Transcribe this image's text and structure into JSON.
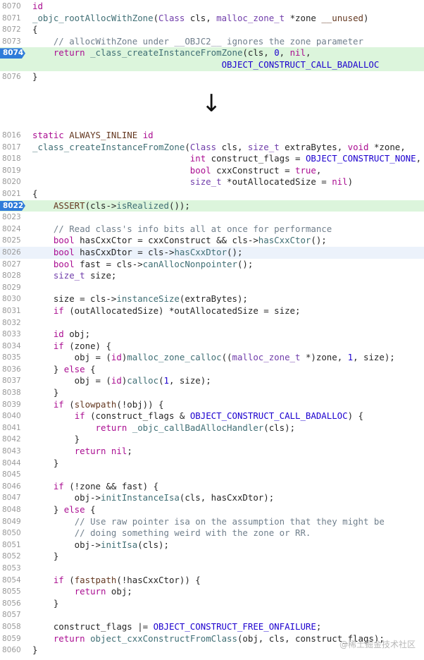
{
  "arrow_symbol": "↓",
  "watermark": "@稀土掘金技术社区",
  "top_snippet": [
    {
      "num": "8070",
      "tokens": [
        [
          "kw",
          "id"
        ]
      ]
    },
    {
      "num": "8071",
      "tokens": [
        [
          "fn",
          "_objc_rootAllocWithZone"
        ],
        [
          "id",
          "("
        ],
        [
          "ty",
          "Class"
        ],
        [
          "id",
          " cls, "
        ],
        [
          "ty",
          "malloc_zone_t"
        ],
        [
          "id",
          " *zone "
        ],
        [
          "mc",
          "__unused"
        ],
        [
          "id",
          ")"
        ]
      ]
    },
    {
      "num": "8072",
      "tokens": [
        [
          "id",
          "{"
        ]
      ]
    },
    {
      "num": "8073",
      "tokens": [
        [
          "id",
          "    "
        ],
        [
          "cm",
          "// allocWithZone under __OBJC2__ ignores the zone parameter"
        ]
      ]
    },
    {
      "num": "8074",
      "badge": true,
      "highlight": "green",
      "tokens": [
        [
          "id",
          "    "
        ],
        [
          "kw",
          "return"
        ],
        [
          "id",
          " "
        ],
        [
          "fn",
          "_class_createInstanceFromZone"
        ],
        [
          "id",
          "(cls, "
        ],
        [
          "cn",
          "0"
        ],
        [
          "id",
          ", "
        ],
        [
          "kw",
          "nil"
        ],
        [
          "id",
          ","
        ]
      ]
    },
    {
      "num": "",
      "highlight": "green",
      "tokens": [
        [
          "id",
          "                                    "
        ],
        [
          "cn",
          "OBJECT_CONSTRUCT_CALL_BADALLOC"
        ]
      ]
    },
    {
      "num": "8076",
      "tokens": [
        [
          "id",
          "}"
        ]
      ]
    }
  ],
  "bottom_snippet": [
    {
      "num": "8016",
      "tokens": [
        [
          "kw",
          "static"
        ],
        [
          "id",
          " "
        ],
        [
          "mc",
          "ALWAYS_INLINE"
        ],
        [
          "id",
          " "
        ],
        [
          "kw",
          "id"
        ]
      ]
    },
    {
      "num": "8017",
      "tokens": [
        [
          "fn",
          "_class_createInstanceFromZone"
        ],
        [
          "id",
          "("
        ],
        [
          "ty",
          "Class"
        ],
        [
          "id",
          " cls, "
        ],
        [
          "ty",
          "size_t"
        ],
        [
          "id",
          " extraBytes, "
        ],
        [
          "kw",
          "void"
        ],
        [
          "id",
          " *zone,"
        ]
      ]
    },
    {
      "num": "8018",
      "tokens": [
        [
          "id",
          "                              "
        ],
        [
          "kw",
          "int"
        ],
        [
          "id",
          " construct_flags = "
        ],
        [
          "cn",
          "OBJECT_CONSTRUCT_NONE"
        ],
        [
          "id",
          ","
        ]
      ]
    },
    {
      "num": "8019",
      "tokens": [
        [
          "id",
          "                              "
        ],
        [
          "kw",
          "bool"
        ],
        [
          "id",
          " cxxConstruct = "
        ],
        [
          "kw",
          "true"
        ],
        [
          "id",
          ","
        ]
      ]
    },
    {
      "num": "8020",
      "tokens": [
        [
          "id",
          "                              "
        ],
        [
          "ty",
          "size_t"
        ],
        [
          "id",
          " *outAllocatedSize = "
        ],
        [
          "kw",
          "nil"
        ],
        [
          "id",
          ")"
        ]
      ]
    },
    {
      "num": "8021",
      "tokens": [
        [
          "id",
          "{"
        ]
      ]
    },
    {
      "num": "8022",
      "badge": true,
      "highlight": "green",
      "tokens": [
        [
          "id",
          "    "
        ],
        [
          "mc",
          "ASSERT"
        ],
        [
          "id",
          "(cls->"
        ],
        [
          "fn",
          "isRealized"
        ],
        [
          "id",
          "());"
        ]
      ]
    },
    {
      "num": "8023",
      "tokens": []
    },
    {
      "num": "8024",
      "tokens": [
        [
          "id",
          "    "
        ],
        [
          "cm",
          "// Read class's info bits all at once for performance"
        ]
      ]
    },
    {
      "num": "8025",
      "tokens": [
        [
          "id",
          "    "
        ],
        [
          "kw",
          "bool"
        ],
        [
          "id",
          " hasCxxCtor = cxxConstruct && cls->"
        ],
        [
          "fn",
          "hasCxxCtor"
        ],
        [
          "id",
          "();"
        ]
      ]
    },
    {
      "num": "8026",
      "highlight": "current",
      "tokens": [
        [
          "id",
          "    "
        ],
        [
          "kw",
          "bool"
        ],
        [
          "id",
          " hasCxxDtor = cls->"
        ],
        [
          "fn",
          "hasCxxDtor"
        ],
        [
          "id",
          "();"
        ]
      ]
    },
    {
      "num": "8027",
      "tokens": [
        [
          "id",
          "    "
        ],
        [
          "kw",
          "bool"
        ],
        [
          "id",
          " fast = cls->"
        ],
        [
          "fn",
          "canAllocNonpointer"
        ],
        [
          "id",
          "();"
        ]
      ]
    },
    {
      "num": "8028",
      "tokens": [
        [
          "id",
          "    "
        ],
        [
          "ty",
          "size_t"
        ],
        [
          "id",
          " size;"
        ]
      ]
    },
    {
      "num": "8029",
      "tokens": []
    },
    {
      "num": "8030",
      "tokens": [
        [
          "id",
          "    size = cls->"
        ],
        [
          "fn",
          "instanceSize"
        ],
        [
          "id",
          "(extraBytes);"
        ]
      ]
    },
    {
      "num": "8031",
      "tokens": [
        [
          "id",
          "    "
        ],
        [
          "kw",
          "if"
        ],
        [
          "id",
          " (outAllocatedSize) *outAllocatedSize = size;"
        ]
      ]
    },
    {
      "num": "8032",
      "tokens": []
    },
    {
      "num": "8033",
      "tokens": [
        [
          "id",
          "    "
        ],
        [
          "kw",
          "id"
        ],
        [
          "id",
          " obj;"
        ]
      ]
    },
    {
      "num": "8034",
      "tokens": [
        [
          "id",
          "    "
        ],
        [
          "kw",
          "if"
        ],
        [
          "id",
          " (zone) {"
        ]
      ]
    },
    {
      "num": "8035",
      "tokens": [
        [
          "id",
          "        obj = ("
        ],
        [
          "kw",
          "id"
        ],
        [
          "id",
          ")"
        ],
        [
          "fn",
          "malloc_zone_calloc"
        ],
        [
          "id",
          "(("
        ],
        [
          "ty",
          "malloc_zone_t"
        ],
        [
          "id",
          " *)zone, "
        ],
        [
          "cn",
          "1"
        ],
        [
          "id",
          ", size);"
        ]
      ]
    },
    {
      "num": "8036",
      "tokens": [
        [
          "id",
          "    } "
        ],
        [
          "kw",
          "else"
        ],
        [
          "id",
          " {"
        ]
      ]
    },
    {
      "num": "8037",
      "tokens": [
        [
          "id",
          "        obj = ("
        ],
        [
          "kw",
          "id"
        ],
        [
          "id",
          ")"
        ],
        [
          "fn",
          "calloc"
        ],
        [
          "id",
          "("
        ],
        [
          "cn",
          "1"
        ],
        [
          "id",
          ", size);"
        ]
      ]
    },
    {
      "num": "8038",
      "tokens": [
        [
          "id",
          "    }"
        ]
      ]
    },
    {
      "num": "8039",
      "tokens": [
        [
          "id",
          "    "
        ],
        [
          "kw",
          "if"
        ],
        [
          "id",
          " ("
        ],
        [
          "mc",
          "slowpath"
        ],
        [
          "id",
          "(!obj)) {"
        ]
      ]
    },
    {
      "num": "8040",
      "tokens": [
        [
          "id",
          "        "
        ],
        [
          "kw",
          "if"
        ],
        [
          "id",
          " (construct_flags & "
        ],
        [
          "cn",
          "OBJECT_CONSTRUCT_CALL_BADALLOC"
        ],
        [
          "id",
          ") {"
        ]
      ]
    },
    {
      "num": "8041",
      "tokens": [
        [
          "id",
          "            "
        ],
        [
          "kw",
          "return"
        ],
        [
          "id",
          " "
        ],
        [
          "fn",
          "_objc_callBadAllocHandler"
        ],
        [
          "id",
          "(cls);"
        ]
      ]
    },
    {
      "num": "8042",
      "tokens": [
        [
          "id",
          "        }"
        ]
      ]
    },
    {
      "num": "8043",
      "tokens": [
        [
          "id",
          "        "
        ],
        [
          "kw",
          "return"
        ],
        [
          "id",
          " "
        ],
        [
          "kw",
          "nil"
        ],
        [
          "id",
          ";"
        ]
      ]
    },
    {
      "num": "8044",
      "tokens": [
        [
          "id",
          "    }"
        ]
      ]
    },
    {
      "num": "8045",
      "tokens": []
    },
    {
      "num": "8046",
      "tokens": [
        [
          "id",
          "    "
        ],
        [
          "kw",
          "if"
        ],
        [
          "id",
          " (!zone && fast) {"
        ]
      ]
    },
    {
      "num": "8047",
      "tokens": [
        [
          "id",
          "        obj->"
        ],
        [
          "fn",
          "initInstanceIsa"
        ],
        [
          "id",
          "(cls, hasCxxDtor);"
        ]
      ]
    },
    {
      "num": "8048",
      "tokens": [
        [
          "id",
          "    } "
        ],
        [
          "kw",
          "else"
        ],
        [
          "id",
          " {"
        ]
      ]
    },
    {
      "num": "8049",
      "tokens": [
        [
          "id",
          "        "
        ],
        [
          "cm",
          "// Use raw pointer isa on the assumption that they might be"
        ]
      ]
    },
    {
      "num": "8050",
      "tokens": [
        [
          "id",
          "        "
        ],
        [
          "cm",
          "// doing something weird with the zone or RR."
        ]
      ]
    },
    {
      "num": "8051",
      "tokens": [
        [
          "id",
          "        obj->"
        ],
        [
          "fn",
          "initIsa"
        ],
        [
          "id",
          "(cls);"
        ]
      ]
    },
    {
      "num": "8052",
      "tokens": [
        [
          "id",
          "    }"
        ]
      ]
    },
    {
      "num": "8053",
      "tokens": []
    },
    {
      "num": "8054",
      "tokens": [
        [
          "id",
          "    "
        ],
        [
          "kw",
          "if"
        ],
        [
          "id",
          " ("
        ],
        [
          "mc",
          "fastpath"
        ],
        [
          "id",
          "(!hasCxxCtor)) {"
        ]
      ]
    },
    {
      "num": "8055",
      "tokens": [
        [
          "id",
          "        "
        ],
        [
          "kw",
          "return"
        ],
        [
          "id",
          " obj;"
        ]
      ]
    },
    {
      "num": "8056",
      "tokens": [
        [
          "id",
          "    }"
        ]
      ]
    },
    {
      "num": "8057",
      "tokens": []
    },
    {
      "num": "8058",
      "tokens": [
        [
          "id",
          "    construct_flags |= "
        ],
        [
          "cn",
          "OBJECT_CONSTRUCT_FREE_ONFAILURE"
        ],
        [
          "id",
          ";"
        ]
      ]
    },
    {
      "num": "8059",
      "tokens": [
        [
          "id",
          "    "
        ],
        [
          "kw",
          "return"
        ],
        [
          "id",
          " "
        ],
        [
          "fn",
          "object_cxxConstructFromClass"
        ],
        [
          "id",
          "(obj, cls, construct_flags);"
        ]
      ]
    },
    {
      "num": "8060",
      "tokens": [
        [
          "id",
          "}"
        ]
      ]
    }
  ]
}
